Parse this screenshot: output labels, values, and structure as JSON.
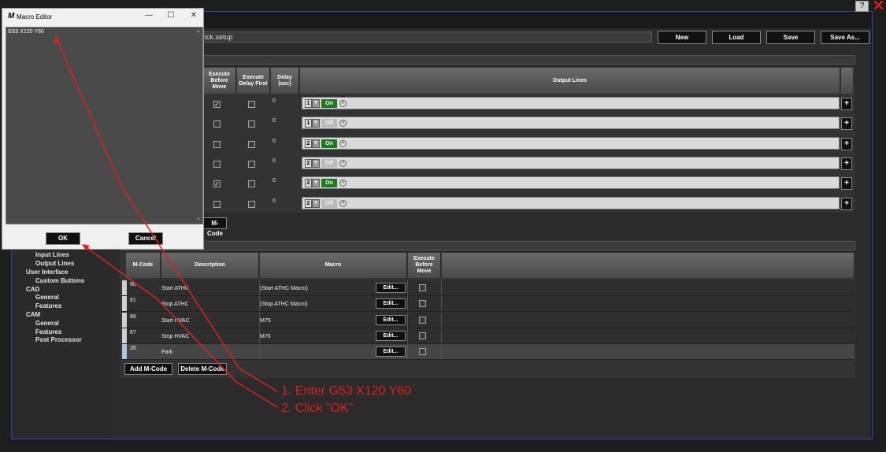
{
  "dialog": {
    "title": "Macro Editor",
    "logo": "M",
    "editor_text": "G53 X120 Y60",
    "ok_label": "OK",
    "cancel_label": "Cancel"
  },
  "window": {
    "help_label": "?",
    "close_label": "✕"
  },
  "toolbar": {
    "filename": "rick.setup",
    "new_label": "New",
    "load_label": "Load",
    "save_label": "Save",
    "save_as_label": "Save As..."
  },
  "output_table": {
    "headers": {
      "execute_before_move": "Execute Before Move",
      "execute_delay_first": "Execute Delay First",
      "delay": "Delay (sec)",
      "output_lines": "Output Lines"
    },
    "rows": [
      {
        "before": true,
        "delay_first": false,
        "delay": "0",
        "line": "1",
        "state": "On"
      },
      {
        "before": false,
        "delay_first": false,
        "delay": "0",
        "line": "1",
        "state": "Off"
      },
      {
        "before": false,
        "delay_first": false,
        "delay": "0",
        "line": "2",
        "state": "On"
      },
      {
        "before": false,
        "delay_first": false,
        "delay": "0",
        "line": "2",
        "state": "Off"
      },
      {
        "before": true,
        "delay_first": false,
        "delay": "0",
        "line": "2",
        "state": "On"
      },
      {
        "before": false,
        "delay_first": false,
        "delay": "0",
        "line": "2",
        "state": "Off"
      }
    ],
    "add_mcode_partial": "M-Code"
  },
  "sidebar": {
    "items": [
      {
        "label": "Input Lines",
        "level": 1
      },
      {
        "label": "Output Lines",
        "level": 1
      },
      {
        "label": "User Interface",
        "level": 0
      },
      {
        "label": "Custom Buttons",
        "level": 1
      },
      {
        "label": "CAD",
        "level": 0
      },
      {
        "label": "General",
        "level": 1
      },
      {
        "label": "Features",
        "level": 1
      },
      {
        "label": "CAM",
        "level": 0
      },
      {
        "label": "General",
        "level": 1
      },
      {
        "label": "Features",
        "level": 1
      },
      {
        "label": "Post Processor",
        "level": 1
      }
    ]
  },
  "mcode_table": {
    "headers": {
      "mcode": "M-Code",
      "description": "Description",
      "macro": "Macro",
      "execute_before_move": "Execute Before Move"
    },
    "rows": [
      {
        "mcode": "80",
        "description": "Start ATHC",
        "macro": "(Start ATHC Macro)",
        "edit": "Edit..."
      },
      {
        "mcode": "81",
        "description": "Stop ATHC",
        "macro": "(Stop ATHC Macro)",
        "edit": "Edit..."
      },
      {
        "mcode": "66",
        "description": "Start HVAC",
        "macro": "M75",
        "edit": "Edit..."
      },
      {
        "mcode": "67",
        "description": "Stop HVAC",
        "macro": "M76",
        "edit": "Edit..."
      },
      {
        "mcode": "26",
        "description": "Park",
        "macro": "",
        "edit": "Edit..."
      }
    ],
    "add_label": "Add M-Code",
    "delete_label": "Delete M-Code"
  },
  "annotations": {
    "step1": "1. Enter G53 X120 Y60",
    "step2": "2. Click \"OK\""
  },
  "colors": {
    "annotation": "#e0201a",
    "on": "#1e7a1e",
    "border_accent": "#3b3bd0"
  }
}
